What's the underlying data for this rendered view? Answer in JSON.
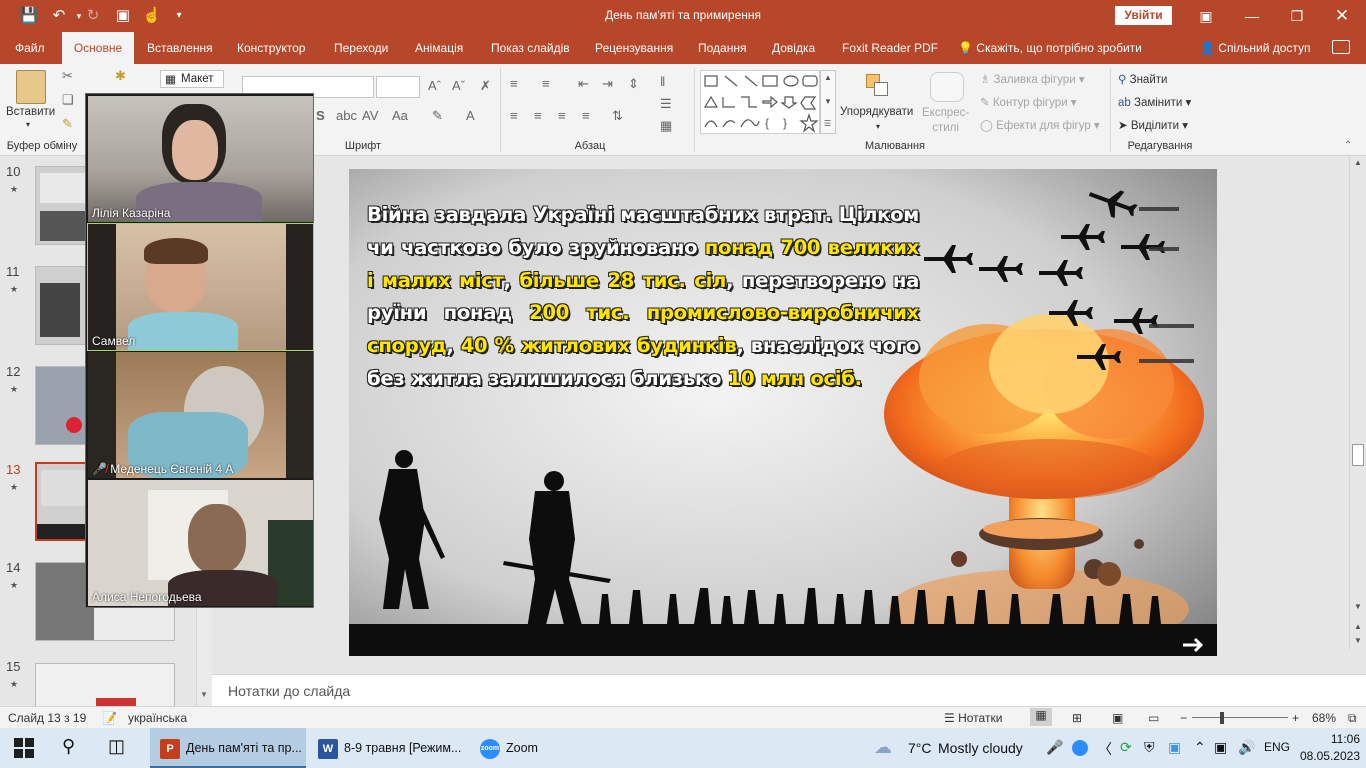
{
  "window": {
    "title": "День пам'яті та примирення",
    "signin_label": "Увійти"
  },
  "ribbon_tabs": [
    "Файл",
    "Основне",
    "Вставлення",
    "Конструктор",
    "Переходи",
    "Анімація",
    "Показ слайдів",
    "Рецензування",
    "Подання",
    "Довідка",
    "Foxit Reader PDF"
  ],
  "tell_me": "Скажіть, що потрібно зробити",
  "share": "Спільний доступ",
  "ribbon": {
    "paste_label": "Вставити",
    "layout_label": "Макет",
    "clipboard_group": "Буфер обміну",
    "font_group": "Шрифт",
    "paragraph_group": "Абзац",
    "drawing_group": "Малювання",
    "editing_group": "Редагування",
    "arrange_label": "Упорядкувати",
    "express_styles_label": "Експрес-\nстилі",
    "shape_fill": "Заливка фігури",
    "shape_outline": "Контур фігури",
    "shape_effects": "Ефекти для фігур",
    "find": "Знайти",
    "replace": "Замінити",
    "select": "Виділити"
  },
  "thumbnails": [
    {
      "num": "10"
    },
    {
      "num": "11"
    },
    {
      "num": "12"
    },
    {
      "num": "13",
      "selected": true
    },
    {
      "num": "14"
    },
    {
      "num": "15"
    }
  ],
  "zoom_participants": [
    {
      "name": "Лілія Казаріна",
      "muted": false,
      "active": false
    },
    {
      "name": "Самвел",
      "muted": false,
      "active": true
    },
    {
      "name": "Меденець Євгеній 4 А",
      "muted": true,
      "active": false
    },
    {
      "name": "Алиса Непогодьева",
      "muted": false,
      "active": false
    }
  ],
  "slide": {
    "text_parts": [
      {
        "t": "Війна завдала Україні масштабних втрат. Цілком чи частково було зруйновано ",
        "hl": false
      },
      {
        "t": "понад 700 великих і малих міст",
        "hl": true
      },
      {
        "t": ", ",
        "hl": false
      },
      {
        "t": "більше 28 тис. сіл",
        "hl": true
      },
      {
        "t": ", перетворено на руїни  понад ",
        "hl": false
      },
      {
        "t": "200 тис. промислово-виробничих споруд",
        "hl": true
      },
      {
        "t": ", ",
        "hl": false
      },
      {
        "t": "40 % житлових будинків",
        "hl": true
      },
      {
        "t": ", внаслідок чого без житла залишилося близько ",
        "hl": false
      },
      {
        "t": "10 млн осіб.",
        "hl": true
      }
    ]
  },
  "notes_placeholder": "Нотатки до слайда",
  "status": {
    "slide_of": "Слайд 13 з 19",
    "language": "українська",
    "notes_btn": "Нотатки",
    "zoom_level": "68%"
  },
  "taskbar": {
    "apps": [
      "День пам'яті та пр...",
      "8-9 травня [Режим...",
      "Zoom"
    ],
    "weather_temp": "7°C",
    "weather_desc": "Mostly cloudy",
    "lang": "ENG",
    "time": "11:06",
    "date": "08.05.2023"
  },
  "colors": {
    "accent": "#b7472a",
    "highlight": "#ffe500"
  }
}
